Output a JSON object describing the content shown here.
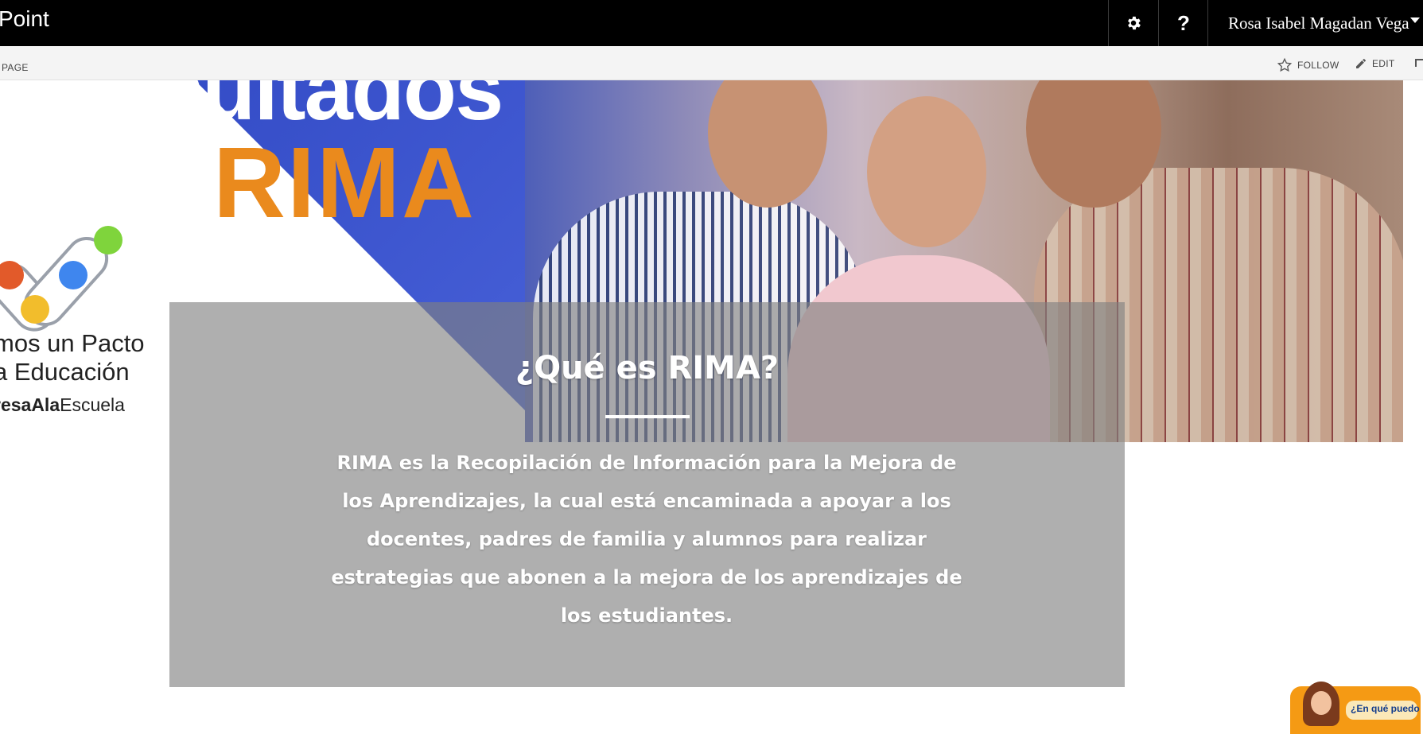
{
  "suite_bar": {
    "app_title": "Point",
    "settings_icon": "gear-icon",
    "help_label": "?",
    "user_name": "Rosa Isabel Magadan Vega"
  },
  "ribbon": {
    "page_label": "PAGE",
    "follow_label": "FOLLOW",
    "edit_label": "EDIT"
  },
  "hero": {
    "headline_fragment": "resultados",
    "rima_word": "RIMA",
    "logo_line1": "mos un Pacto",
    "logo_line2": "a Educación",
    "logo_line3_bold": "resaAla",
    "logo_line3_rest": "Escuela"
  },
  "card": {
    "title": "¿Qué es RIMA?",
    "body": "RIMA es la Recopilación de Información para la Mejora de los Aprendizajes, la cual está encaminada a apoyar a los docentes, padres de familia y alumnos para realizar estrategias que abonen a la mejora de los aprendizajes de los estudiantes."
  },
  "chat_widget": {
    "label": "¿En qué puedo"
  },
  "colors": {
    "suite_bar": "#000000",
    "hero_blue": "#3f55c5",
    "rima_orange": "#ea8a1d",
    "card_overlay": "rgba(128,128,128,0.63)",
    "chat_orange": "#f59a14"
  }
}
